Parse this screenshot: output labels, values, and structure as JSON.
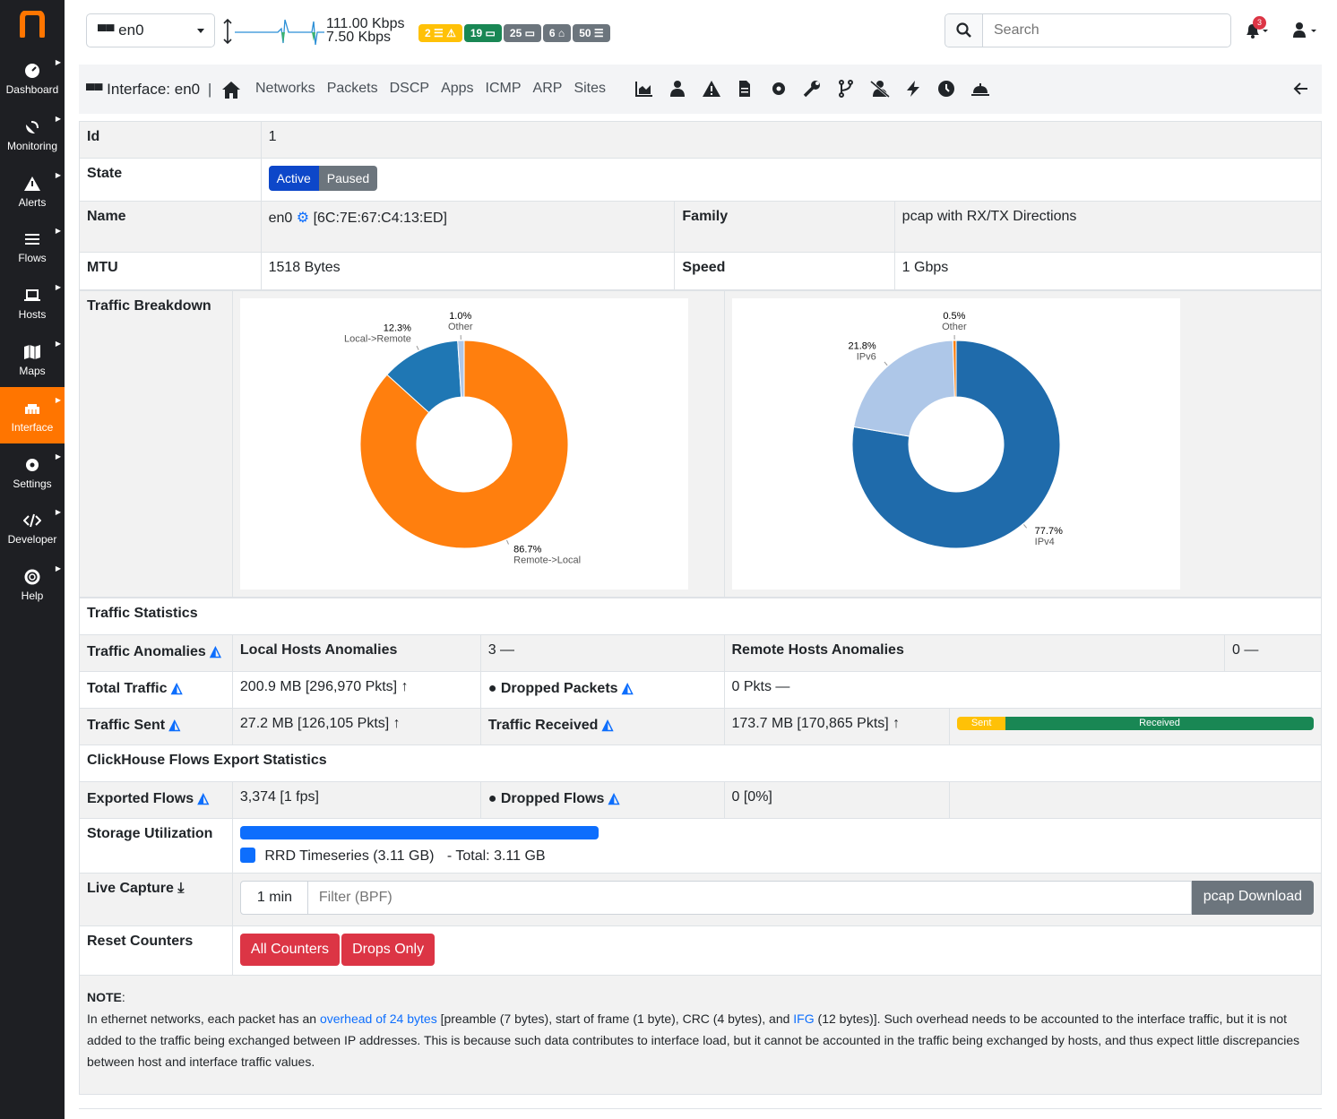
{
  "sidebar": {
    "items": [
      {
        "label": "Dashboard",
        "icon": "gauge-icon"
      },
      {
        "label": "Monitoring",
        "icon": "satellite-dish-icon"
      },
      {
        "label": "Alerts",
        "icon": "warning-icon"
      },
      {
        "label": "Flows",
        "icon": "list-icon"
      },
      {
        "label": "Hosts",
        "icon": "laptop-icon"
      },
      {
        "label": "Maps",
        "icon": "map-icon"
      },
      {
        "label": "Interface",
        "icon": "ethernet-icon",
        "active": true
      },
      {
        "label": "Settings",
        "icon": "gear-icon"
      },
      {
        "label": "Developer",
        "icon": "code-icon"
      },
      {
        "label": "Help",
        "icon": "life-ring-icon"
      }
    ]
  },
  "topbar": {
    "interface": "en0",
    "rate_up": "111.00 Kbps",
    "rate_down": "7.50 Kbps",
    "badges": [
      {
        "text": "2 ☰ ⚠",
        "color": "#ffc107"
      },
      {
        "text": "19 ▭",
        "color": "#198754"
      },
      {
        "text": "25 ▭",
        "color": "#6c757d"
      },
      {
        "text": "6 ⌂",
        "color": "#6c757d"
      },
      {
        "text": "50 ☰",
        "color": "#6c757d"
      }
    ],
    "search_placeholder": "Search",
    "notifications": "3"
  },
  "nav": {
    "title": "Interface: en0",
    "links": [
      "Networks",
      "Packets",
      "DSCP",
      "Apps",
      "ICMP",
      "ARP",
      "Sites"
    ]
  },
  "info": {
    "id_label": "Id",
    "id": "1",
    "state_label": "State",
    "active": "Active",
    "paused": "Paused",
    "name_label": "Name",
    "name": "en0",
    "mac": "[6C:7E:67:C4:13:ED]",
    "family_label": "Family",
    "family": "pcap with RX/TX Directions",
    "mtu_label": "MTU",
    "mtu": "1518 Bytes",
    "speed_label": "Speed",
    "speed": "1 Gbps",
    "breakdown_label": "Traffic Breakdown"
  },
  "chart_data": [
    {
      "type": "pie",
      "slices": [
        {
          "label": "Remote->Local",
          "value": 86.7,
          "color": "#ff7f0e"
        },
        {
          "label": "Local->Remote",
          "value": 12.3,
          "color": "#1f77b4"
        },
        {
          "label": "Other",
          "value": 1.0,
          "color": "#aec7e8"
        }
      ]
    },
    {
      "type": "pie",
      "slices": [
        {
          "label": "IPv4",
          "value": 77.7,
          "color": "#1f6bab"
        },
        {
          "label": "IPv6",
          "value": 21.8,
          "color": "#aec7e8"
        },
        {
          "label": "Other",
          "value": 0.5,
          "color": "#ff7f0e"
        }
      ]
    }
  ],
  "stats": {
    "title": "Traffic Statistics",
    "anomalies_label": "Traffic Anomalies",
    "local_anom_label": "Local Hosts Anomalies",
    "local_anom": "3 —",
    "remote_anom_label": "Remote Hosts Anomalies",
    "remote_anom": "0 —",
    "total_label": "Total Traffic",
    "total": "200.9 MB [296,970 Pkts] ↑",
    "dropped_label": "Dropped Packets",
    "dropped": "0 Pkts —",
    "sent_label": "Traffic Sent",
    "sent": "27.2 MB [126,105 Pkts] ↑",
    "recv_label": "Traffic Received",
    "recv": "173.7 MB [170,865 Pkts] ↑",
    "bar_sent": "Sent",
    "bar_recv": "Received",
    "sent_share": 13.5
  },
  "clickhouse": {
    "title": "ClickHouse Flows Export Statistics",
    "exported_label": "Exported Flows",
    "exported": "3,374 [1 fps]",
    "dropped_label": "Dropped Flows",
    "dropped": "0 [0%]"
  },
  "storage": {
    "label": "Storage Utilization",
    "legend": "RRD Timeseries (3.11 GB)",
    "total": "-  Total: 3.11 GB"
  },
  "capture": {
    "label": "Live Capture",
    "duration": "1 min",
    "filter_placeholder": "Filter (BPF)",
    "download": "pcap Download"
  },
  "reset": {
    "label": "Reset Counters",
    "all": "All Counters",
    "drops": "Drops Only"
  },
  "note": {
    "title": "NOTE",
    "p1": "In ethernet networks, each packet has an ",
    "link1": "overhead of 24 bytes",
    "p2": " [preamble (7 bytes), start of frame (1 byte), CRC (4 bytes), and ",
    "link2": "IFG",
    "p3": " (12 bytes)]. Such overhead needs to be accounted to the interface traffic, but it is not added to the traffic being exchanged between IP addresses. This is because such data contributes to interface load, but it cannot be accounted in the traffic being exchanged by hosts, and thus expect little discrepancies between host and interface traffic values."
  }
}
